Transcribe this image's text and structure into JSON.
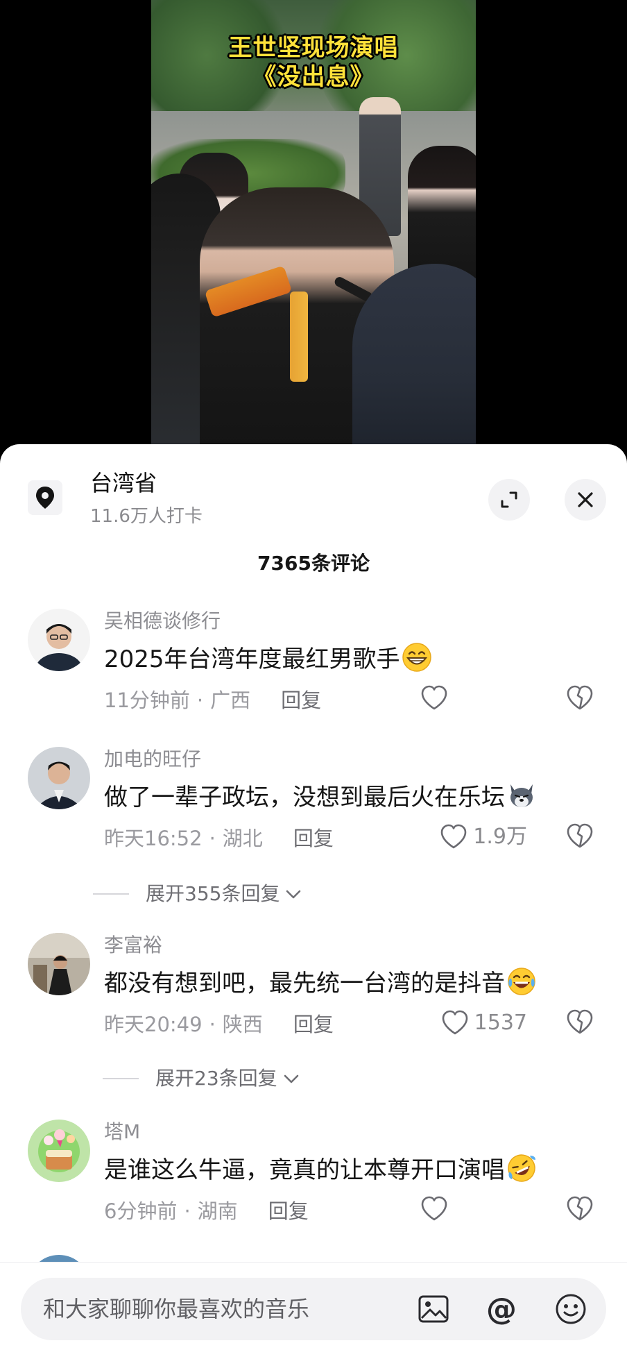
{
  "video": {
    "caption_line1": "王世坚现场演唱",
    "caption_line2": "《没出息》"
  },
  "location": {
    "title": "台湾省",
    "subtitle": "11.6万人打卡"
  },
  "comments_header": {
    "count_label": "7365条评论"
  },
  "comments": [
    {
      "user": "吴相德谈修行",
      "text": "2025年台湾年度最红男歌手",
      "emoji": "grin-emoji",
      "time": "11分钟前",
      "region": "广西",
      "reply_label": "回复",
      "likes": "",
      "expand_label": ""
    },
    {
      "user": "加电的旺仔",
      "text": "做了一辈子政坛，没想到最后火在乐坛",
      "emoji": "dog-emoji",
      "time": "昨天16:52",
      "region": "湖北",
      "reply_label": "回复",
      "likes": "1.9万",
      "expand_label": "展开355条回复"
    },
    {
      "user": "李富裕",
      "text": "都没有想到吧，最先统一台湾的是抖音",
      "emoji": "laugh-cry-emoji",
      "time": "昨天20:49",
      "region": "陕西",
      "reply_label": "回复",
      "likes": "1537",
      "expand_label": "展开23条回复"
    },
    {
      "user": "塔M",
      "text": "是谁这么牛逼，竟真的让本尊开口演唱",
      "emoji": "rofl-emoji",
      "time": "6分钟前",
      "region": "湖南",
      "reply_label": "回复",
      "likes": "",
      "expand_label": ""
    }
  ],
  "input": {
    "placeholder": "和大家聊聊你最喜欢的音乐",
    "at_symbol": "@"
  },
  "colors": {
    "caption": "#ffe23a",
    "muted_text": "#8d8d92",
    "primary_text": "#161616"
  }
}
